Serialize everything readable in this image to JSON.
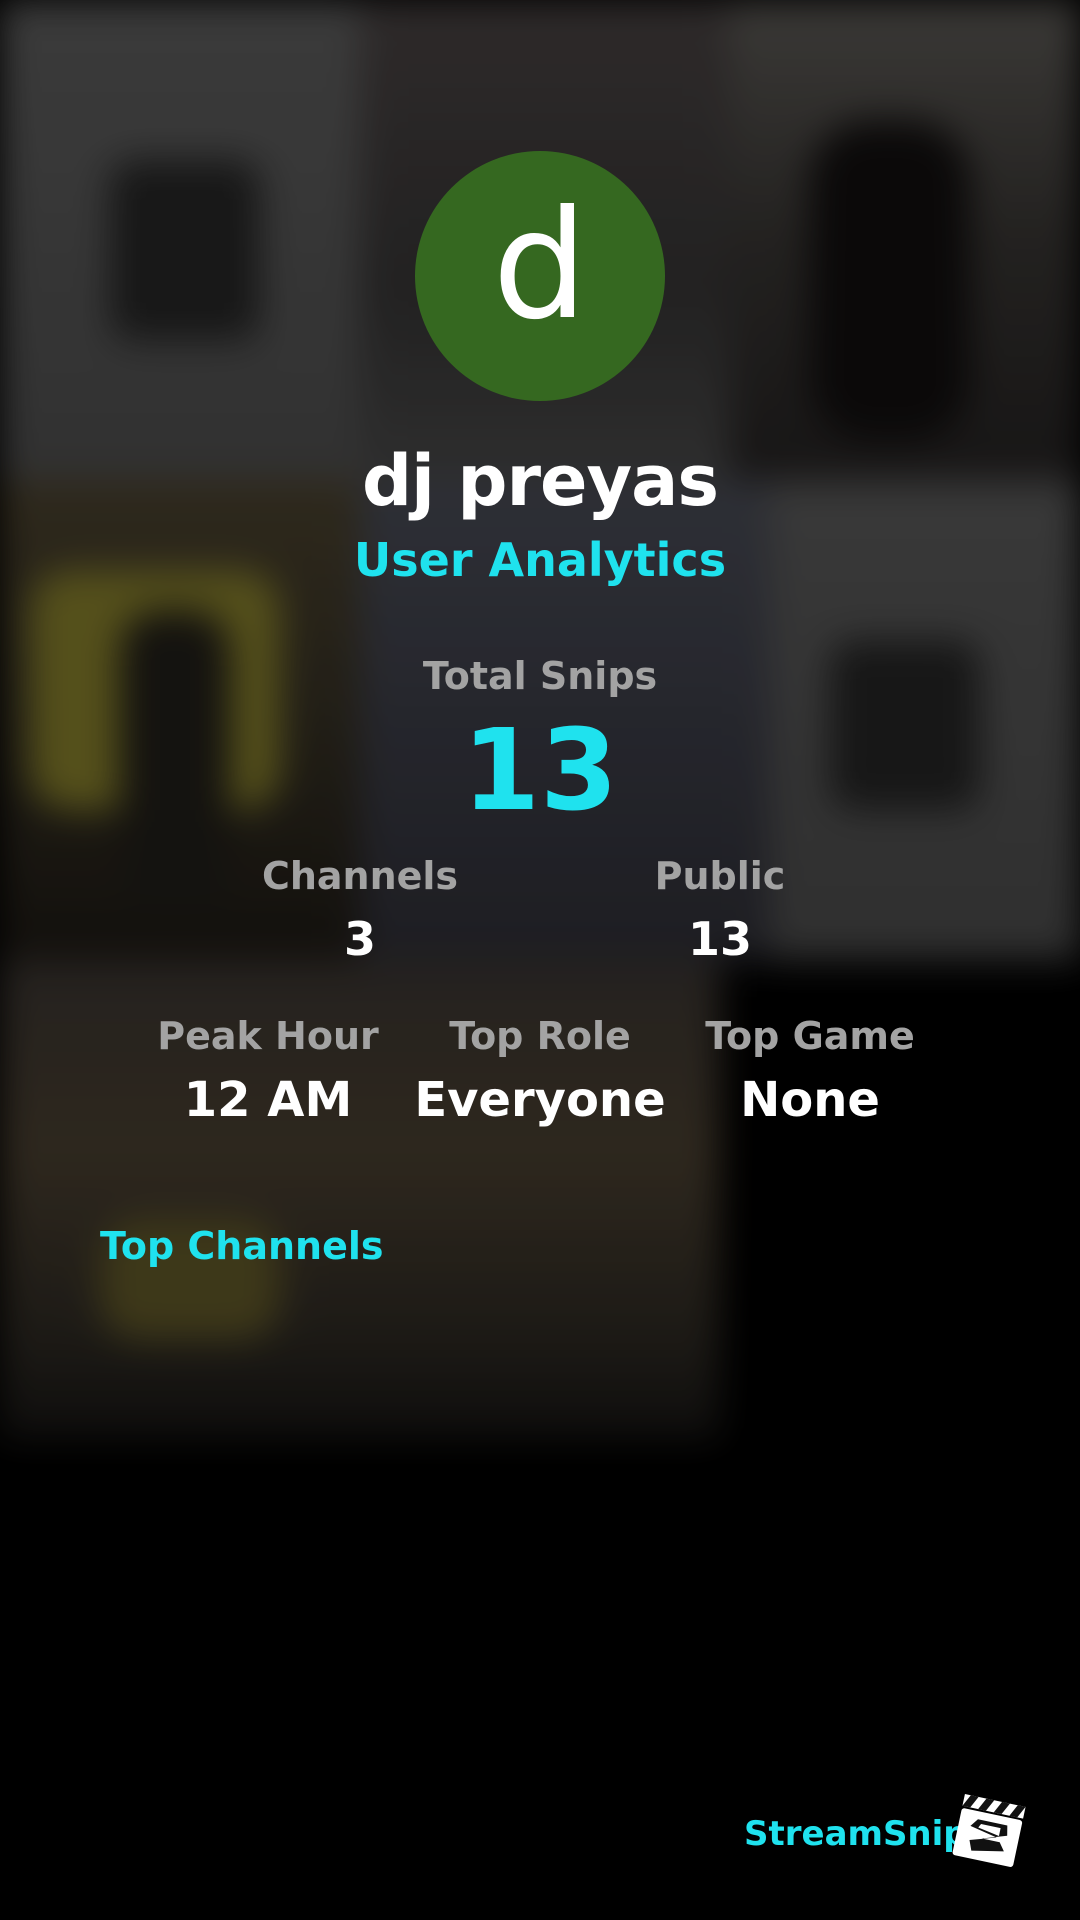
{
  "profile": {
    "avatar_letter": "d",
    "avatar_color": "#356820",
    "username": "dj preyas",
    "subtitle": "User Analytics"
  },
  "stats": {
    "total_snips_label": "Total Snips",
    "total_snips_value": "13",
    "channels_label": "Channels",
    "channels_value": "3",
    "public_label": "Public",
    "public_value": "13",
    "peak_hour_label": "Peak Hour",
    "peak_hour_value": "12 AM",
    "top_role_label": "Top Role",
    "top_role_value": "Everyone",
    "top_game_label": "Top Game",
    "top_game_value": "None"
  },
  "sections": {
    "top_channels_title": "Top Channels"
  },
  "brand": {
    "name": "StreamSnip",
    "logo_icon": "clapperboard-logo-icon",
    "accent_color": "#1fe2ee"
  }
}
